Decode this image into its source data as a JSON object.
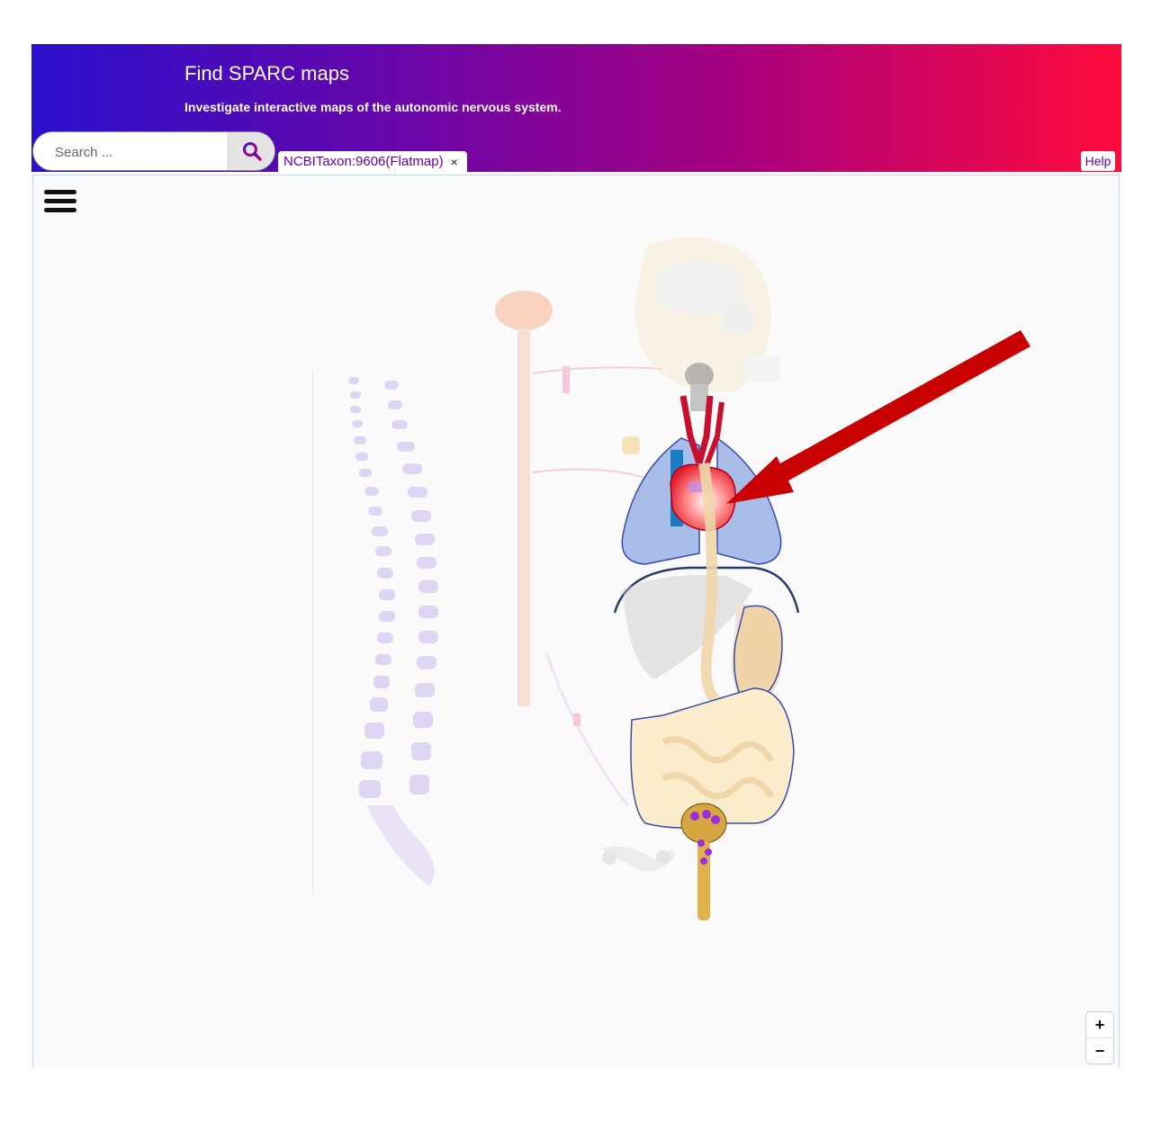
{
  "header": {
    "title": "Find SPARC maps",
    "subtitle": "Investigate interactive maps of the autonomic nervous system.",
    "gradient_start": "#2a10cc",
    "gradient_end": "#ff0a3c"
  },
  "search": {
    "placeholder": "Search ...",
    "icon": "search-icon"
  },
  "tabs": [
    {
      "label": "NCBITaxon:9606(Flatmap)",
      "close": "×"
    }
  ],
  "help": {
    "label": "Help"
  },
  "map": {
    "menu_icon": "hamburger-menu-icon",
    "zoom_in": "+",
    "zoom_out": "−",
    "highlighted_organ": "heart",
    "annotation_color": "#c80000"
  }
}
